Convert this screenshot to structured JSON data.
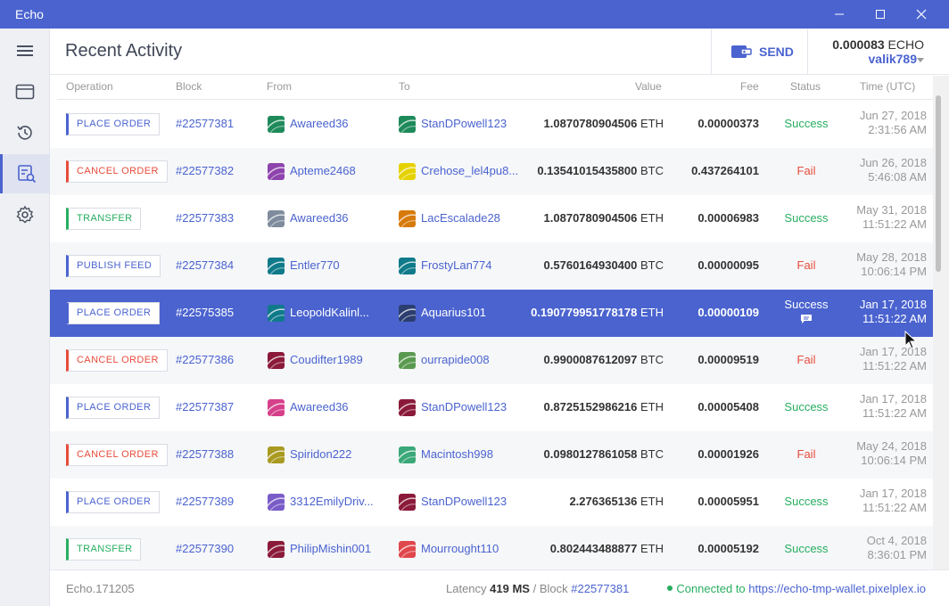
{
  "window": {
    "title": "Echo"
  },
  "header": {
    "title": "Recent Activity",
    "send_label": "SEND",
    "balance_amount": "0.000083",
    "balance_currency": "ECHO",
    "username": "valik789"
  },
  "columns": {
    "operation": "Operation",
    "block": "Block",
    "from": "From",
    "to": "To",
    "value": "Value",
    "fee": "Fee",
    "status": "Status",
    "time": "Time (UTC)"
  },
  "rows": [
    {
      "operation": "PLACE ORDER",
      "op_color": "#4a63cf",
      "block": "#22577381",
      "from": "Awareed36",
      "from_color": "#1e8a5a",
      "to": "StanDPowell123",
      "to_color": "#1e8a5a",
      "value": "1.0870780904506",
      "currency": "ETH",
      "fee": "0.00000373",
      "status": "Success",
      "time1": "Jun 27, 2018",
      "time2": "2:31:56 AM"
    },
    {
      "operation": "CANCEL ORDER",
      "op_color": "#e74c3c",
      "block": "#22577382",
      "from": "Apteme2468",
      "from_color": "#8e44ad",
      "to": "Crehose_lel4pu8...",
      "to_color": "#e6d200",
      "value": "0.13541015435800",
      "currency": "BTC",
      "fee": "0.437264101",
      "status": "Fail",
      "time1": "Jun 26, 2018",
      "time2": "5:46:08 AM"
    },
    {
      "operation": "TRANSFER",
      "op_color": "#27ae60",
      "block": "#22577383",
      "from": "Awareed36",
      "from_color": "#7f8c9d",
      "to": "LacEscalade28",
      "to_color": "#d67a0a",
      "value": "1.0870780904506",
      "currency": "ETH",
      "fee": "0.00006983",
      "status": "Success",
      "time1": "May 31, 2018",
      "time2": "11:51:22 AM"
    },
    {
      "operation": "PUBLISH FEED",
      "op_color": "#4a63cf",
      "block": "#22577384",
      "from": "Entler770",
      "from_color": "#0f7a8a",
      "to": "FrostyLan774",
      "to_color": "#0f7a8a",
      "value": "0.5760164930400",
      "currency": "BTC",
      "fee": "0.00000095",
      "status": "Fail",
      "time1": "May 28, 2018",
      "time2": "10:06:14 PM"
    },
    {
      "operation": "PLACE ORDER",
      "op_color": "#4a63cf",
      "block": "#22575385",
      "from": "LeopoldKalinl...",
      "from_color": "#0f7a8a",
      "to": "Aquarius101",
      "to_color": "#2c3e70",
      "value": "0.190779951778178",
      "currency": "ETH",
      "fee": "0.00000109",
      "status": "Success",
      "time1": "Jan 17, 2018",
      "time2": "11:51:22 AM",
      "selected": true
    },
    {
      "operation": "CANCEL ORDER",
      "op_color": "#e74c3c",
      "block": "#22577386",
      "from": "Coudifter1989",
      "from_color": "#8b1a3a",
      "to": "ourrapide008",
      "to_color": "#5a9a50",
      "value": "0.9900087612097",
      "currency": "BTC",
      "fee": "0.00009519",
      "status": "Fail",
      "time1": "Jan 17, 2018",
      "time2": "11:51:22 AM"
    },
    {
      "operation": "PLACE ORDER",
      "op_color": "#4a63cf",
      "block": "#22577387",
      "from": "Awareed36",
      "from_color": "#d6408a",
      "to": "StanDPowell123",
      "to_color": "#8b1a3a",
      "value": "0.8725152986216",
      "currency": "ETH",
      "fee": "0.00005408",
      "status": "Success",
      "time1": "Jan 17, 2018",
      "time2": "11:51:22 AM"
    },
    {
      "operation": "CANCEL ORDER",
      "op_color": "#e74c3c",
      "block": "#22577388",
      "from": "Spiridon222",
      "from_color": "#a89a20",
      "to": "Macintosh998",
      "to_color": "#3aa878",
      "value": "0.0980127861058",
      "currency": "BTC",
      "fee": "0.00001926",
      "status": "Fail",
      "time1": "May 24, 2018",
      "time2": "10:06:14 PM"
    },
    {
      "operation": "PLACE ORDER",
      "op_color": "#4a63cf",
      "block": "#22577389",
      "from": "3312EmilyDriv...",
      "from_color": "#7a5cc8",
      "to": "StanDPowell123",
      "to_color": "#8b1a3a",
      "value": "2.276365136",
      "currency": "ETH",
      "fee": "0.00005951",
      "status": "Success",
      "time1": "Jan 17, 2018",
      "time2": "11:51:22 AM"
    },
    {
      "operation": "TRANSFER",
      "op_color": "#27ae60",
      "block": "#22577390",
      "from": "PhilipMishin001",
      "from_color": "#8b1a3a",
      "to": "Mourrought110",
      "to_color": "#e0474c",
      "value": "0.802443488877",
      "currency": "ETH",
      "fee": "0.00005192",
      "status": "Success",
      "time1": "Oct 4, 2018",
      "time2": "8:36:01 PM"
    }
  ],
  "footer": {
    "version": "Echo.171205",
    "latency_label": "Latency",
    "latency_value": "419 MS",
    "block_label": "/ Block",
    "block_value": "#22577381",
    "connected_label": "Connected to",
    "connected_url": "https://echo-tmp-wallet.pixelplex.io"
  }
}
